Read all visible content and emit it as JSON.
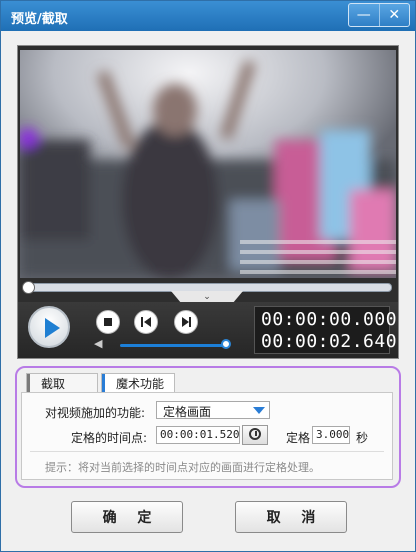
{
  "window": {
    "title": "预览/截取",
    "minimize_icon": "minimize-icon",
    "close_icon": "close-icon"
  },
  "player": {
    "current_time": "00:00:00.000",
    "total_time": "00:00:02.640",
    "progress": 0,
    "volume": 1.0
  },
  "tabs": [
    {
      "label": "截取",
      "active": false
    },
    {
      "label": "魔术功能",
      "active": true
    }
  ],
  "magic": {
    "function_label": "对视频施加的功能:",
    "function_value": "定格画面",
    "time_label": "定格的时间点:",
    "time_value": "00:00:01.520",
    "duration_label": "定格",
    "duration_value": "3.000",
    "seconds_label": "秒",
    "hint": "提示：将对当前选择的时间点对应的画面进行定格处理。"
  },
  "buttons": {
    "ok": "确 定",
    "cancel": "取 消"
  },
  "colors": {
    "accent": "#1f7fd2",
    "title_bar": "#2a7ec6",
    "highlight_border": "#b87be6"
  }
}
